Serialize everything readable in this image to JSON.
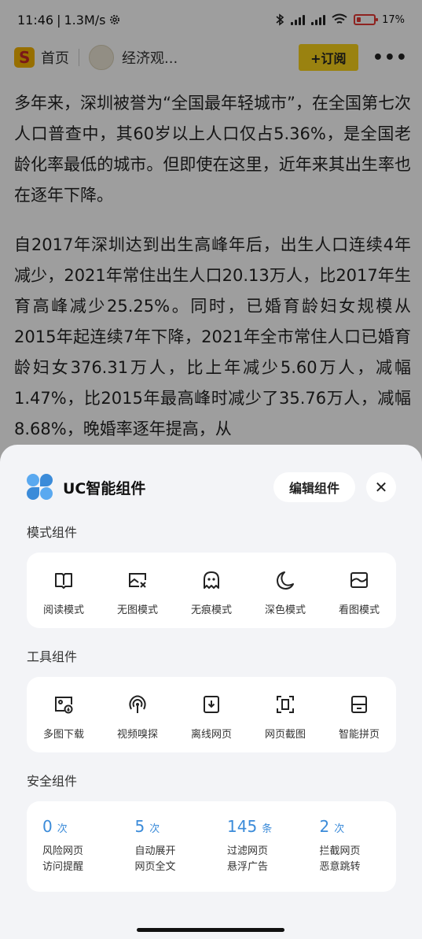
{
  "status_bar": {
    "time": "11:46",
    "speed": "1.3M/s",
    "battery": "17"
  },
  "header": {
    "home_label": "首页",
    "source_name": "经济观...",
    "subscribe_label": "+订阅",
    "more_label": "•••"
  },
  "article": {
    "paragraphs": [
      "多年来，深圳被誉为“全国最年轻城市”，在全国第七次人口普查中，其60岁以上人口仅占5.36%，是全国老龄化率最低的城市。但即使在这里，近年来其出生率也在逐年下降。",
      "自2017年深圳达到出生高峰年后，出生人口连续4年减少，2021年常住出生人口20.13万人，比2017年生育高峰减少25.25%。同时，已婚育龄妇女规模从2015年起连续7年下降，2021年全市常住人口已婚育龄妇女376.31万人，比上年减少5.60万人，减幅1.47%，比2015年最高峰时减少了35.76万人，减幅8.68%，晚婚率逐年提高，从"
    ]
  },
  "sheet": {
    "title": "UC智能组件",
    "edit_label": "编辑组件",
    "close_label": "✕",
    "sections": {
      "mode": {
        "label": "模式组件",
        "items": [
          {
            "label": "阅读模式",
            "icon": "book-icon"
          },
          {
            "label": "无图模式",
            "icon": "no-image-icon"
          },
          {
            "label": "无痕模式",
            "icon": "ghost-icon"
          },
          {
            "label": "深色模式",
            "icon": "moon-icon"
          },
          {
            "label": "看图模式",
            "icon": "image-view-icon"
          }
        ]
      },
      "tools": {
        "label": "工具组件",
        "items": [
          {
            "label": "多图下载",
            "icon": "image-download-icon"
          },
          {
            "label": "视频嗅探",
            "icon": "video-sniff-icon"
          },
          {
            "label": "离线网页",
            "icon": "offline-page-icon"
          },
          {
            "label": "网页截图",
            "icon": "screenshot-icon"
          },
          {
            "label": "智能拼页",
            "icon": "page-join-icon"
          }
        ]
      },
      "security": {
        "label": "安全组件",
        "stats": [
          {
            "num": "0",
            "unit": "次",
            "line1": "风险网页",
            "line2": "访问提醒"
          },
          {
            "num": "5",
            "unit": "次",
            "line1": "自动展开",
            "line2": "网页全文"
          },
          {
            "num": "145",
            "unit": "条",
            "line1": "过滤网页",
            "line2": "悬浮广告"
          },
          {
            "num": "2",
            "unit": "次",
            "line1": "拦截网页",
            "line2": "恶意跳转"
          }
        ]
      }
    }
  },
  "colors": {
    "accent_blue": "#3b8bd9",
    "subscribe_yellow": "#f8d21a",
    "battery_red": "#e53935"
  }
}
